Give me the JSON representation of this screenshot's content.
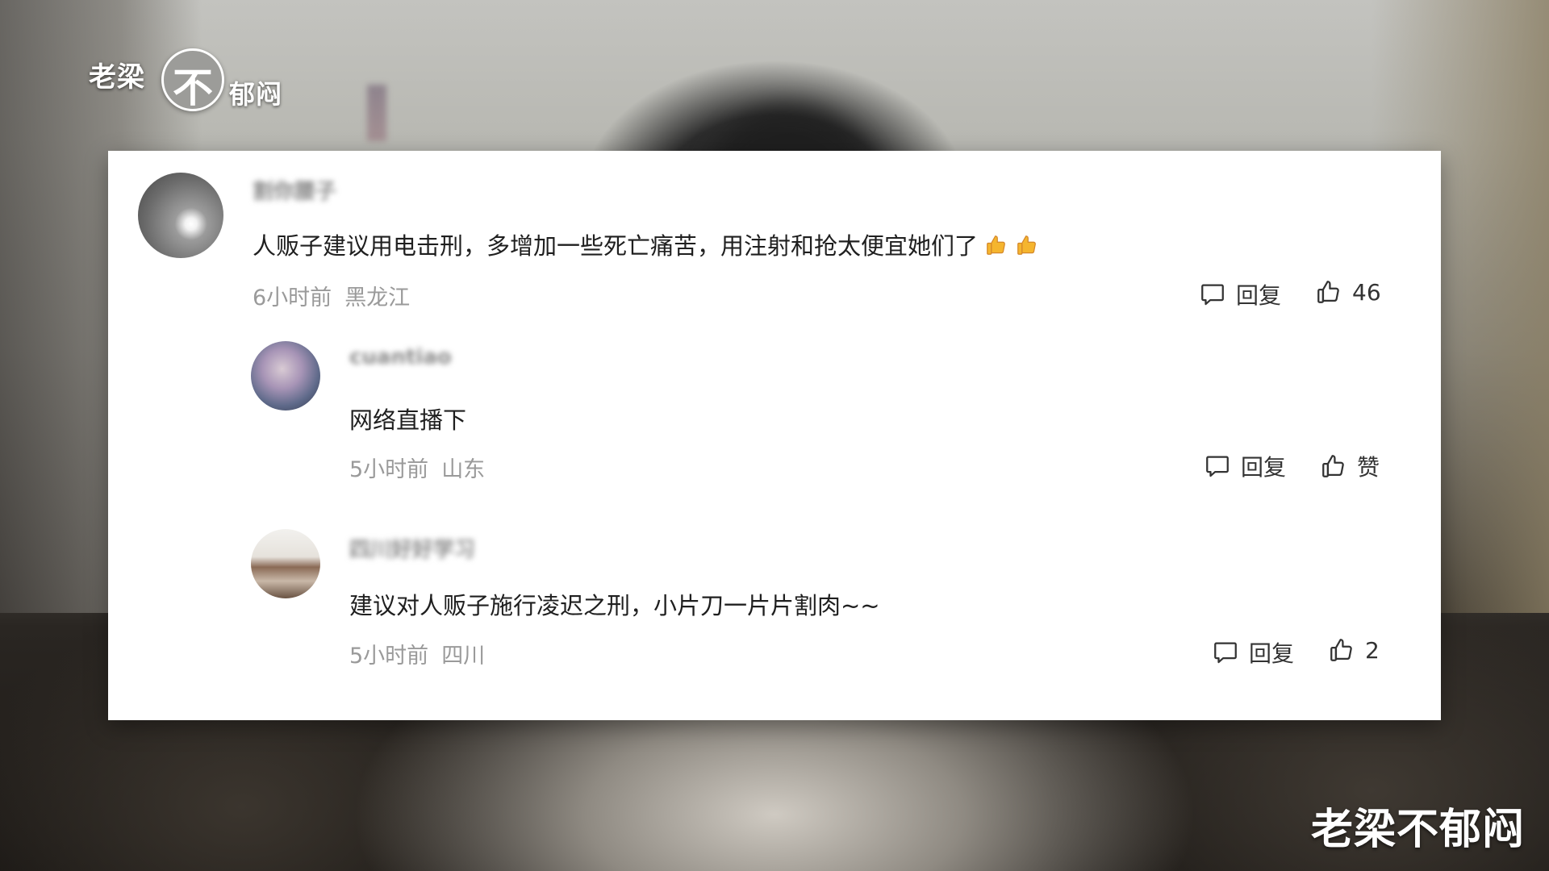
{
  "logo": {
    "left_text": "老梁",
    "circle_text": "不",
    "right_text": "郁闷"
  },
  "watermark": "老梁不郁闷",
  "comments": [
    {
      "username": "割你腰子",
      "avatar_icon": "profile-avatar",
      "text": "人贩子建议用电击刑，多增加一些死亡痛苦，用注射和抢太便宜她们了",
      "emoji": [
        "thumbs-up-emoji",
        "thumbs-up-emoji"
      ],
      "time": "6小时前",
      "location": "黑龙江",
      "reply_label": "回复",
      "like_label": "46"
    },
    {
      "username": "cuantiao",
      "avatar_icon": "profile-avatar",
      "text": "网络直播下",
      "time": "5小时前",
      "location": "山东",
      "reply_label": "回复",
      "like_label": "赞"
    },
    {
      "username": "四川好好学习",
      "avatar_icon": "profile-avatar",
      "text": "建议对人贩子施行凌迟之刑，小片刀一片片割肉~~",
      "time": "5小时前",
      "location": "四川",
      "reply_label": "回复",
      "like_label": "2"
    }
  ],
  "colors": {
    "card_background": "#ffffff",
    "text_primary": "#1f1f1f",
    "text_meta": "#9a9a9a",
    "action_text": "#333333",
    "emoji": "#f5b52e"
  }
}
